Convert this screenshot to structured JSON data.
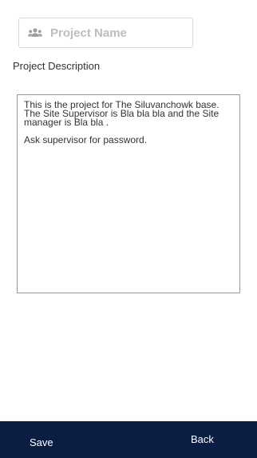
{
  "form": {
    "project_name": {
      "value": "",
      "placeholder": "Project Name",
      "icon": "users-icon"
    },
    "description": {
      "label": "Project Description",
      "value": "This is the project for The Siluvanchowk base. The Site Supervisor is Bla bla bla and the Site manager is Bla bla .\n\nAsk supervisor for password."
    }
  },
  "footer": {
    "save_label": "Save",
    "back_label": "Back"
  },
  "colors": {
    "footer_bg": "#0c1d44",
    "footer_text": "#ffffff",
    "placeholder": "#bdbdbd"
  }
}
